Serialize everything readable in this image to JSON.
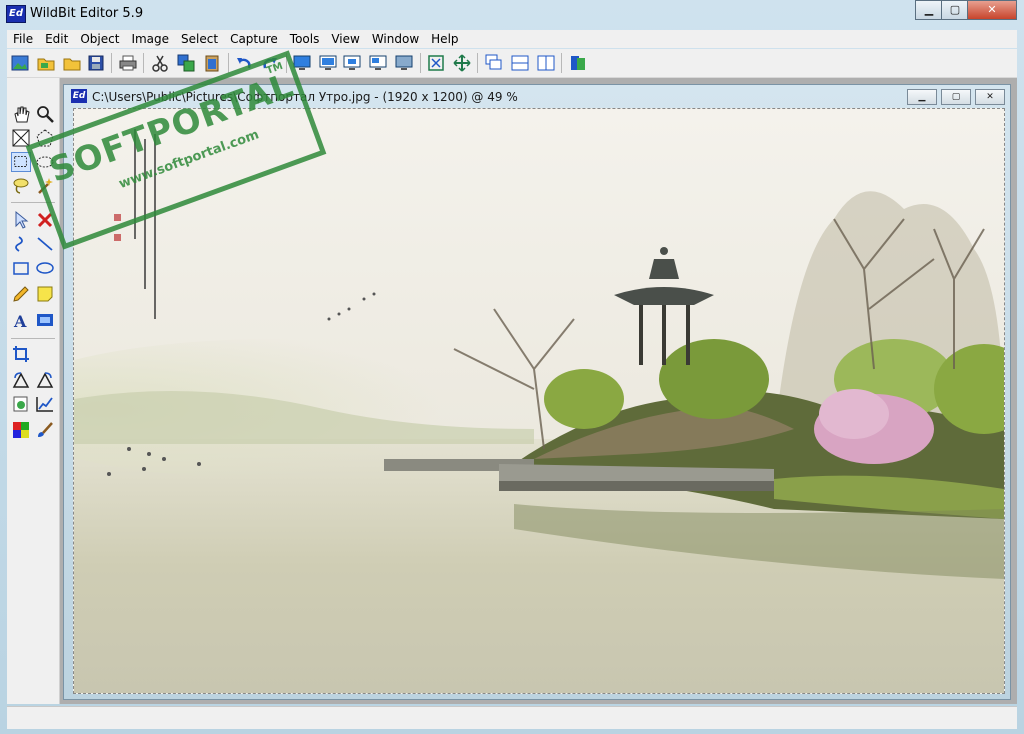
{
  "window": {
    "title": "WildBit Editor 5.9",
    "icon_text": "Ed",
    "minimize": "▁",
    "maximize": "▢",
    "close": "✕"
  },
  "menu": [
    "File",
    "Edit",
    "Object",
    "Image",
    "Select",
    "Capture",
    "Tools",
    "View",
    "Window",
    "Help"
  ],
  "toolbar_icons": [
    "new-image-icon",
    "open-icon",
    "open-folder-icon",
    "save-icon",
    "print-icon",
    "cut-icon",
    "copy-icon",
    "paste-icon",
    "undo-icon",
    "redo-icon",
    "screen-capture-icon",
    "window-capture-icon",
    "region-capture-icon",
    "object-capture-icon",
    "full-capture-icon",
    "fit-window-icon",
    "actual-size-icon",
    "cascade-icon",
    "tile-horizontal-icon",
    "tile-vertical-icon",
    "info-icon"
  ],
  "tools": [
    "hand-icon",
    "zoom-icon",
    "crop-box-icon",
    "polygon-select-icon",
    "rect-select-icon",
    "ellipse-select-icon",
    "lasso-icon",
    "magic-wand-icon",
    "pointer-icon",
    "delete-icon",
    "curve-icon",
    "line-icon",
    "rectangle-icon",
    "ellipse-icon",
    "pencil-icon",
    "note-icon",
    "text-icon",
    "filmstrip-icon",
    "crop-icon",
    "rotate-left-icon",
    "rotate-right-icon",
    "resize-icon",
    "levels-icon",
    "colors-icon",
    "brush-icon"
  ],
  "document": {
    "icon_text": "Ed",
    "title": "C:\\Users\\Public\\Pictures\\Софтпортал Утро.jpg - (1920 x 1200) @ 49  %",
    "minimize": "▁",
    "maximize": "▢",
    "close": "✕"
  },
  "watermark": {
    "brand": "SOFTPORTAL",
    "url": "www.softportal.com",
    "tm": "TM"
  },
  "colors": {
    "accent": "#1a2fb0",
    "watermark": "#2f8a3a"
  }
}
